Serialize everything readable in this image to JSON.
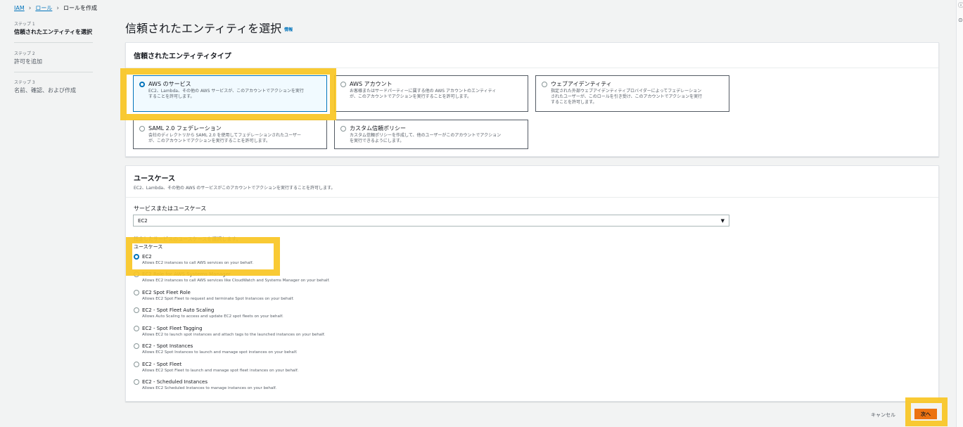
{
  "breadcrumb": {
    "iam": "IAM",
    "roles": "ロール",
    "create": "ロールを作成"
  },
  "steps": [
    {
      "num": "ステップ 1",
      "label": "信頼されたエンティティを選択"
    },
    {
      "num": "ステップ 2",
      "label": "許可を追加"
    },
    {
      "num": "ステップ 3",
      "label": "名前、確認、および作成"
    }
  ],
  "page": {
    "title": "信頼されたエンティティを選択",
    "info": "情報"
  },
  "entity_panel": {
    "header": "信頼されたエンティティタイプ",
    "tiles": [
      {
        "label": "AWS のサービス",
        "desc1": "EC2、Lambda、その他の AWS サービスが、このアカウントでアクションを実行",
        "desc2": "することを許可します。",
        "desc3": ""
      },
      {
        "label": "AWS アカウント",
        "desc1": "お客様またはサードパーティーに属する他の AWS アカウントのエンティティ",
        "desc2": "が、このアカウントでアクションを実行することを許可します。",
        "desc3": ""
      },
      {
        "label": "ウェブアイデンティティ",
        "desc1": "指定された外部ウェブアイデンティティプロバイダーによってフェデレーション",
        "desc2": "されたユーザーが、このロールを引き受け、このアカウントでアクションを実行",
        "desc3": "することを許可します。"
      },
      {
        "label": "SAML 2.0 フェデレーション",
        "desc1": "会社のディレクトリから SAML 2.0 を使用してフェデレーションされたユーザー",
        "desc2": "が、このアカウントでアクションを実行することを許可します。",
        "desc3": ""
      },
      {
        "label": "カスタム信頼ポリシー",
        "desc1": "カスタム信頼ポリシーを作成して、他のユーザーがこのアカウントでアクション",
        "desc2": "を実行できるようにします。",
        "desc3": ""
      }
    ]
  },
  "usecase_panel": {
    "header": "ユースケース",
    "subtitle": "EC2、Lambda、その他の AWS のサービスがこのアカウントでアクションを実行することを許可します。",
    "service_label": "サービスまたはユースケース",
    "service_value": "EC2",
    "choose_text": "指定したサービスのユースケースを選択します。",
    "usecase_label": "ユースケース",
    "items": [
      {
        "label": "EC2",
        "desc": "Allows EC2 instances to call AWS services on your behalf."
      },
      {
        "label": "EC2 Role for AWS Systems Manager",
        "desc": "Allows EC2 instances to call AWS services like CloudWatch and Systems Manager on your behalf."
      },
      {
        "label": "EC2 Spot Fleet Role",
        "desc": "Allows EC2 Spot Fleet to request and terminate Spot Instances on your behalf."
      },
      {
        "label": "EC2 - Spot Fleet Auto Scaling",
        "desc": "Allows Auto Scaling to access and update EC2 spot fleets on your behalf."
      },
      {
        "label": "EC2 - Spot Fleet Tagging",
        "desc": "Allows EC2 to launch spot instances and attach tags to the launched instances on your behalf."
      },
      {
        "label": "EC2 - Spot Instances",
        "desc": "Allows EC2 Spot Instances to launch and manage spot instances on your behalf."
      },
      {
        "label": "EC2 - Spot Fleet",
        "desc": "Allows EC2 Spot Fleet to launch and manage spot fleet instances on your behalf."
      },
      {
        "label": "EC2 - Scheduled Instances",
        "desc": "Allows EC2 Scheduled Instances to manage instances on your behalf."
      }
    ]
  },
  "footer": {
    "cancel": "キャンセル",
    "next": "次へ"
  },
  "colors": {
    "accent": "#0073bb",
    "primary_button": "#ec7211",
    "highlight": "#f9c623"
  },
  "icons": {
    "caret": "chevron-down-icon",
    "breadcrumb_sep": "chevron-right-icon",
    "side_top": "info-circle-icon",
    "side_bottom": "settings-icon"
  }
}
